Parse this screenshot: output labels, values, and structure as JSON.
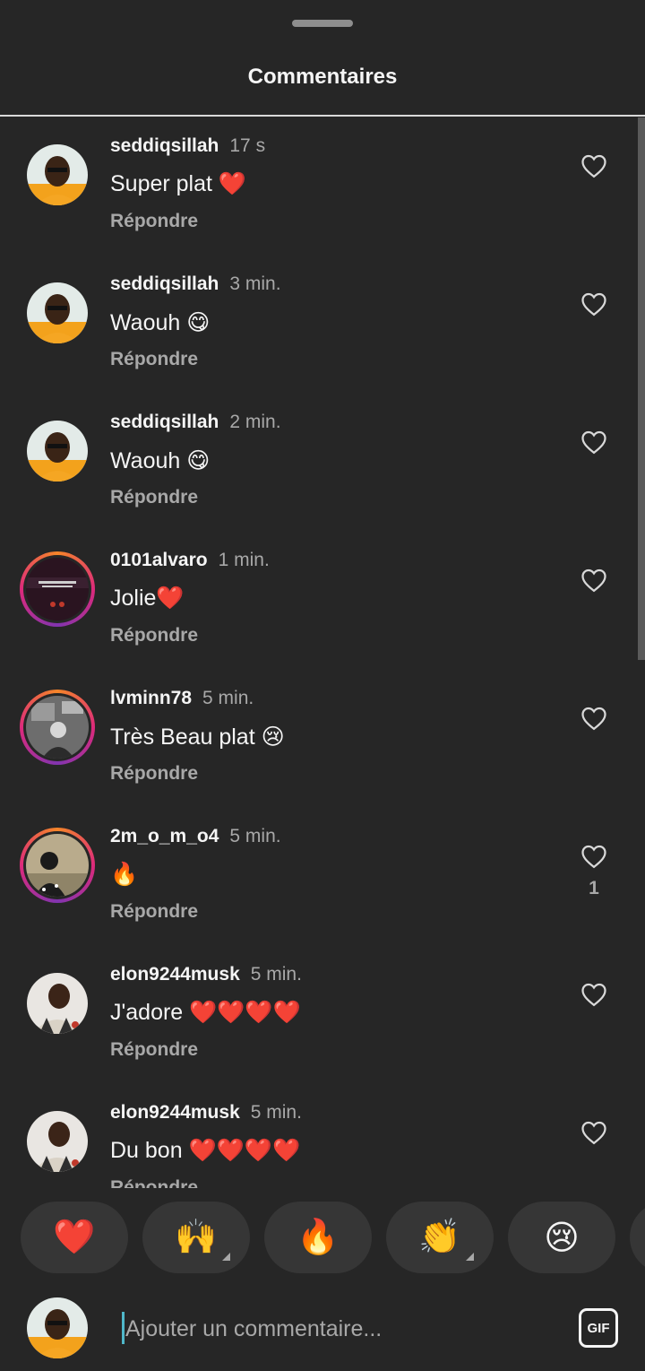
{
  "header": {
    "title": "Commentaires"
  },
  "comments": [
    {
      "username": "seddiqsillah",
      "time": "17 s",
      "text": "Super plat ❤️",
      "reply": "Répondre"
    },
    {
      "username": "seddiqsillah",
      "time": "3 min.",
      "text": "Waouh 😋",
      "reply": "Répondre"
    },
    {
      "username": "seddiqsillah",
      "time": "2 min.",
      "text": "Waouh 😋",
      "reply": "Répondre"
    },
    {
      "username": "0101alvaro",
      "time": "1 min.",
      "text": "Jolie❤️",
      "reply": "Répondre"
    },
    {
      "username": "lvminn78",
      "time": "5 min.",
      "text": "Très Beau plat 😢",
      "reply": "Répondre"
    },
    {
      "username": "2m_o_m_o4",
      "time": "5 min.",
      "text": "🔥",
      "reply": "Répondre",
      "likes": "1"
    },
    {
      "username": "elon9244musk",
      "time": "5 min.",
      "text": "J'adore ❤️❤️❤️❤️",
      "reply": "Répondre"
    },
    {
      "username": "elon9244musk",
      "time": "5 min.",
      "text": "Du bon ❤️❤️❤️❤️",
      "reply": "Répondre"
    }
  ],
  "reactions": [
    "❤️",
    "🙌",
    "🔥",
    "👏",
    "😢"
  ],
  "composer": {
    "placeholder": "Ajouter un commentaire...",
    "gif_label": "GIF"
  },
  "icons": {
    "like": "heart-outline-icon",
    "gif": "gif-icon"
  }
}
